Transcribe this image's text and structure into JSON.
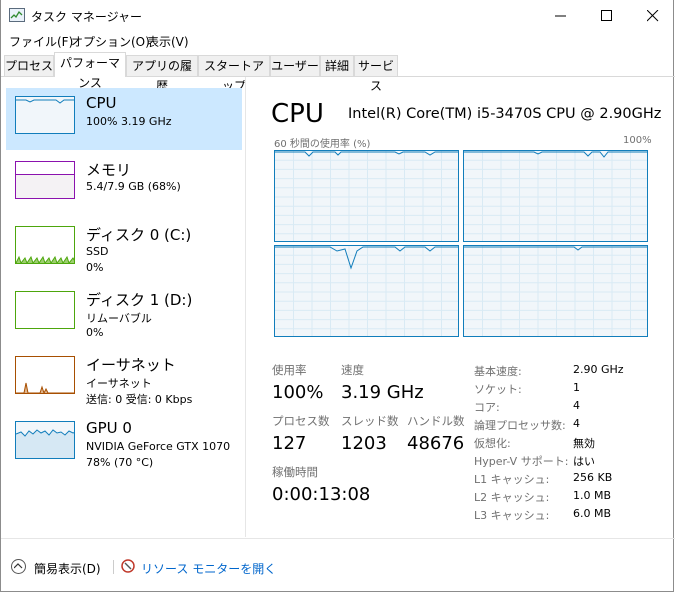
{
  "window": {
    "title": "タスク マネージャー"
  },
  "menu": [
    "ファイル(F)",
    "オプション(O)",
    "表示(V)"
  ],
  "tabs": [
    "プロセス",
    "パフォーマンス",
    "アプリの履歴",
    "スタートアップ",
    "ユーザー",
    "詳細",
    "サービス"
  ],
  "active_tab": "パフォーマンス",
  "sidebar": [
    {
      "title": "CPU",
      "lines": [
        "100%  3.19 GHz"
      ]
    },
    {
      "title": "メモリ",
      "lines": [
        "5.4/7.9 GB (68%)"
      ]
    },
    {
      "title": "ディスク 0 (C:)",
      "lines": [
        "SSD",
        "0%"
      ]
    },
    {
      "title": "ディスク 1 (D:)",
      "lines": [
        "リムーバブル",
        "0%"
      ]
    },
    {
      "title": "イーサネット",
      "lines": [
        "イーサネット",
        "送信: 0  受信: 0 Kbps"
      ]
    },
    {
      "title": "GPU 0",
      "lines": [
        "NVIDIA GeForce GTX 1070",
        "78%  (70 °C)"
      ]
    }
  ],
  "colors": {
    "cpu": "#117dbb",
    "memory": "#8b12ae",
    "disk": "#4da60c",
    "ethernet": "#a74f01",
    "gpu": "#117dbb",
    "selected_bg": "#cce8ff",
    "link": "#0066cc"
  },
  "main": {
    "heading": "CPU",
    "processor": "Intel(R) Core(TM) i5-3470S CPU @ 2.90GHz",
    "graph_label": "60 秒間の使用率 (%)",
    "graph_max": "100%"
  },
  "stats": {
    "usage_label": "使用率",
    "usage": "100%",
    "speed_label": "速度",
    "speed": "3.19 GHz",
    "processes_label": "プロセス数",
    "processes": "127",
    "threads_label": "スレッド数",
    "threads": "1203",
    "handles_label": "ハンドル数",
    "handles": "48676",
    "uptime_label": "稼働時間",
    "uptime": "0:00:13:08"
  },
  "info": [
    {
      "label": "基本速度:",
      "value": "2.90 GHz"
    },
    {
      "label": "ソケット:",
      "value": "1"
    },
    {
      "label": "コア:",
      "value": "4"
    },
    {
      "label": "論理プロセッサ数:",
      "value": "4"
    },
    {
      "label": "仮想化:",
      "value": "無効"
    },
    {
      "label": "Hyper-V サポート:",
      "value": "はい"
    },
    {
      "label": "L1 キャッシュ:",
      "value": "256 KB"
    },
    {
      "label": "L2 キャッシュ:",
      "value": "1.0 MB"
    },
    {
      "label": "L3 キャッシュ:",
      "value": "6.0 MB"
    }
  ],
  "footer": {
    "fewer_details": "簡易表示(D)",
    "resource_monitor": "リソース モニターを開く"
  },
  "icons": {
    "app": "task-manager-icon",
    "minimize": "minimize-icon",
    "maximize": "maximize-icon",
    "close": "close-icon",
    "fewer": "chevron-up-icon",
    "resource_monitor": "resource-monitor-icon"
  }
}
